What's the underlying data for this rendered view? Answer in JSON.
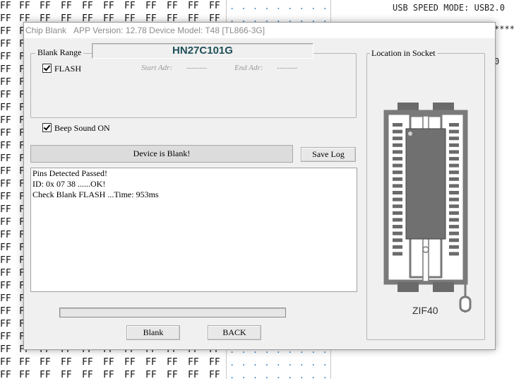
{
  "background": {
    "hex_value": "FF",
    "usb_text": "USB SPEED MODE: USB2.0",
    "stars": "****",
    "zero_text": "0"
  },
  "dialog": {
    "title_app": "Chip Blank",
    "title_info": "APP Version: 12.78 Device Model: T48 [TL866-3G]",
    "chip_name": "HN27C101G",
    "blank_range": {
      "label": "Blank Range",
      "flash_label": "FLASH",
      "flash_checked": true,
      "start_label": "Start Adr:",
      "start_value": "--------",
      "end_label": "End Adr:",
      "end_value": "--------"
    },
    "beep": {
      "label": "Beep Sound ON",
      "checked": true
    },
    "status_text": "Device is Blank!",
    "save_log_label": "Save Log",
    "log_lines": [
      "Pins Detected Passed!",
      "ID: 0x 07 38 ......OK!",
      "Check Blank FLASH ...Time: 953ms"
    ],
    "progress": 0,
    "blank_button": "Blank",
    "back_button": "BACK",
    "socket": {
      "label": "Location in Socket",
      "type_label": "ZIF40",
      "pins_per_side": 20
    }
  },
  "colors": {
    "chip_name": "#1f4f59",
    "dialog_bg": "#f0f0f0",
    "socket": "#7a7a7a",
    "socket_pin": "#6a6a6a",
    "hex_dots": "#2a7fc8"
  }
}
